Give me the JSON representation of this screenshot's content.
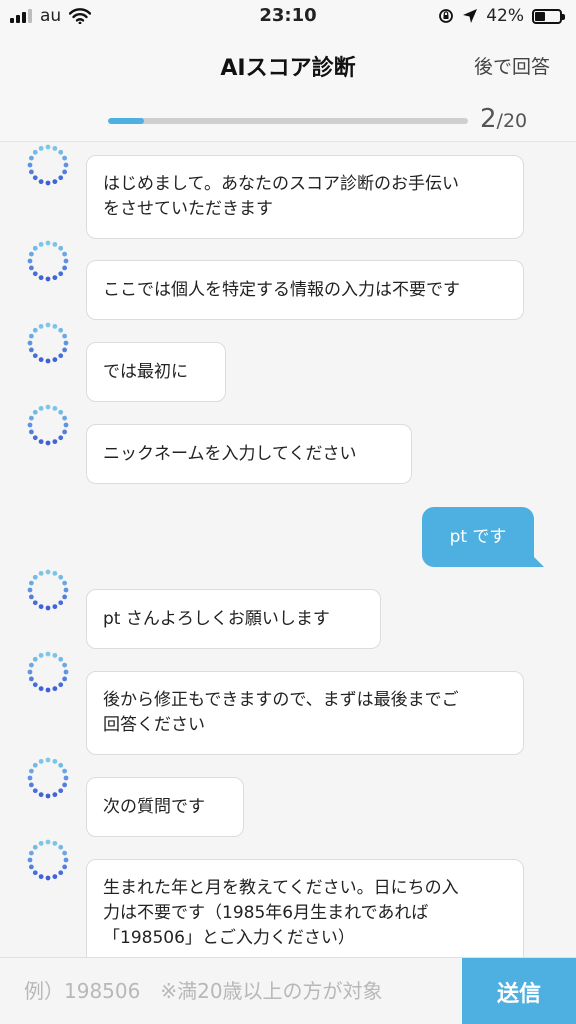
{
  "status_bar": {
    "carrier": "au",
    "time": "23:10",
    "battery": "42%",
    "battery_level": 0.42
  },
  "header": {
    "title": "AIスコア診断",
    "later_label": "後で回答",
    "progress": {
      "current": "2",
      "total": "/20",
      "fraction": 0.1
    }
  },
  "chat": {
    "messages": [
      {
        "sender": "bot",
        "lines": [
          "はじめまして。あなたのスコア診断のお手伝い",
          "をさせていただきます"
        ]
      },
      {
        "sender": "bot",
        "lines": [
          "ここでは個人を特定する情報の入力は不要です"
        ]
      },
      {
        "sender": "bot",
        "lines": [
          "では最初に"
        ]
      },
      {
        "sender": "bot",
        "lines": [
          "ニックネームを入力してください"
        ]
      },
      {
        "sender": "user",
        "lines": [
          "pt です"
        ]
      },
      {
        "sender": "bot",
        "lines": [
          "pt さんよろしくお願いします"
        ]
      },
      {
        "sender": "bot",
        "lines": [
          "後から修正もできますので、まずは最後までご",
          "回答ください"
        ]
      },
      {
        "sender": "bot",
        "lines": [
          "次の質問です"
        ]
      },
      {
        "sender": "bot",
        "lines": [
          "生まれた年と月を教えてください。日にちの入",
          "力は不要です（1985年6月生まれであれば",
          "「198506」とご入力ください）"
        ]
      }
    ]
  },
  "input": {
    "placeholder": "例）198506　※満20歳以上の方が対象",
    "value": "",
    "send_label": "送信"
  },
  "colors": {
    "accent": "#4eb0e0",
    "avatar_top": "#7ec8e8",
    "avatar_bottom": "#3f5fd8"
  }
}
